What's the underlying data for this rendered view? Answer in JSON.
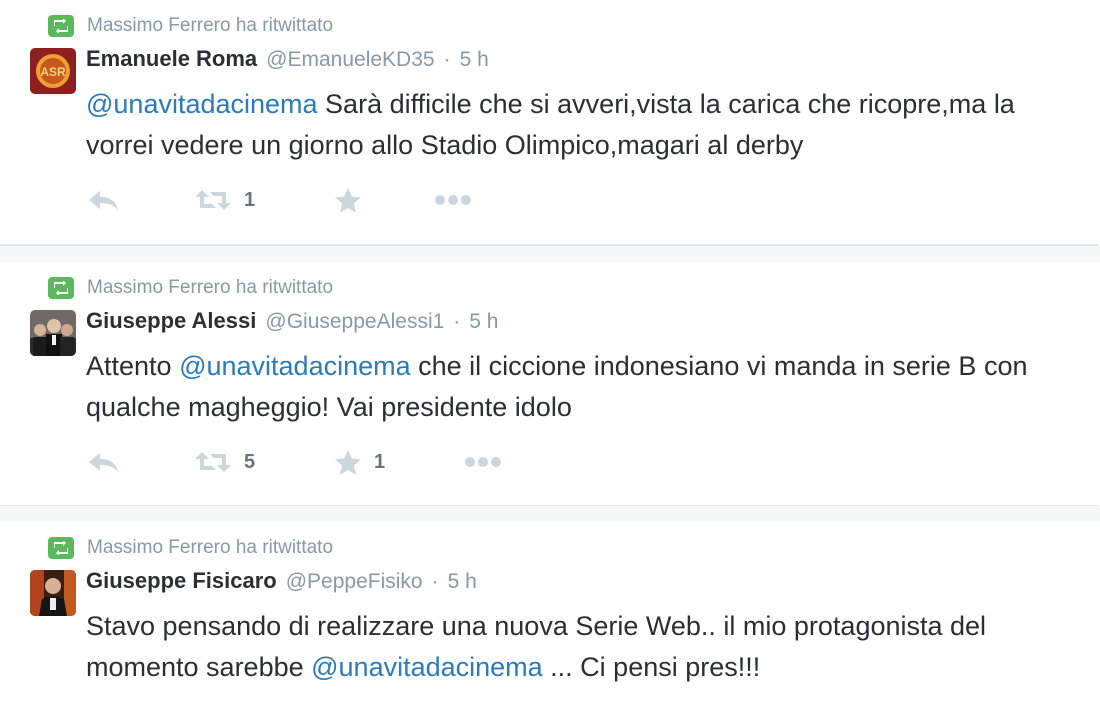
{
  "colors": {
    "mention": "#2b7bb9",
    "icon_gray": "#ccd6dd",
    "retweet_badge": "#5cb85c",
    "meta_gray": "#8899a6"
  },
  "tweets": [
    {
      "context": "Massimo Ferrero ha ritwittato",
      "fullname": "Emanuele Roma",
      "username": "@EmanueleKD35",
      "separator": "·",
      "time": "5 h",
      "text_parts": [
        {
          "text": "@unavitadacinema",
          "mention": true
        },
        {
          "text": " Sarà difficile che si avveri,vista la carica che ricopre,ma la vorrei vedere un giorno allo Stadio Olimpico,magari al derby",
          "mention": false
        }
      ],
      "retweet_count": "1",
      "favorite_count": "",
      "avatar_icon": "as-roma-logo"
    },
    {
      "context": "Massimo Ferrero ha ritwittato",
      "fullname": "Giuseppe Alessi",
      "username": "@GiuseppeAlessi1",
      "separator": "·",
      "time": "5 h",
      "text_parts": [
        {
          "text": "Attento ",
          "mention": false
        },
        {
          "text": "@unavitadacinema",
          "mention": true
        },
        {
          "text": " che il ciccione indonesiano vi manda in serie B con qualche magheggio! Vai presidente idolo",
          "mention": false
        }
      ],
      "retweet_count": "5",
      "favorite_count": "1",
      "avatar_icon": "group-photo"
    },
    {
      "context": "Massimo Ferrero ha ritwittato",
      "fullname": "Giuseppe Fisicaro",
      "username": "@PeppeFisiko",
      "separator": "·",
      "time": "5 h",
      "text_parts": [
        {
          "text": "Stavo pensando di realizzare una nuova Serie Web.. il mio protagonista del momento sarebbe ",
          "mention": false
        },
        {
          "text": "@unavitadacinema",
          "mention": true
        },
        {
          "text": " ... Ci pensi pres!!!",
          "mention": false
        }
      ],
      "retweet_count": "",
      "favorite_count": "",
      "avatar_icon": "portrait-photo"
    }
  ]
}
